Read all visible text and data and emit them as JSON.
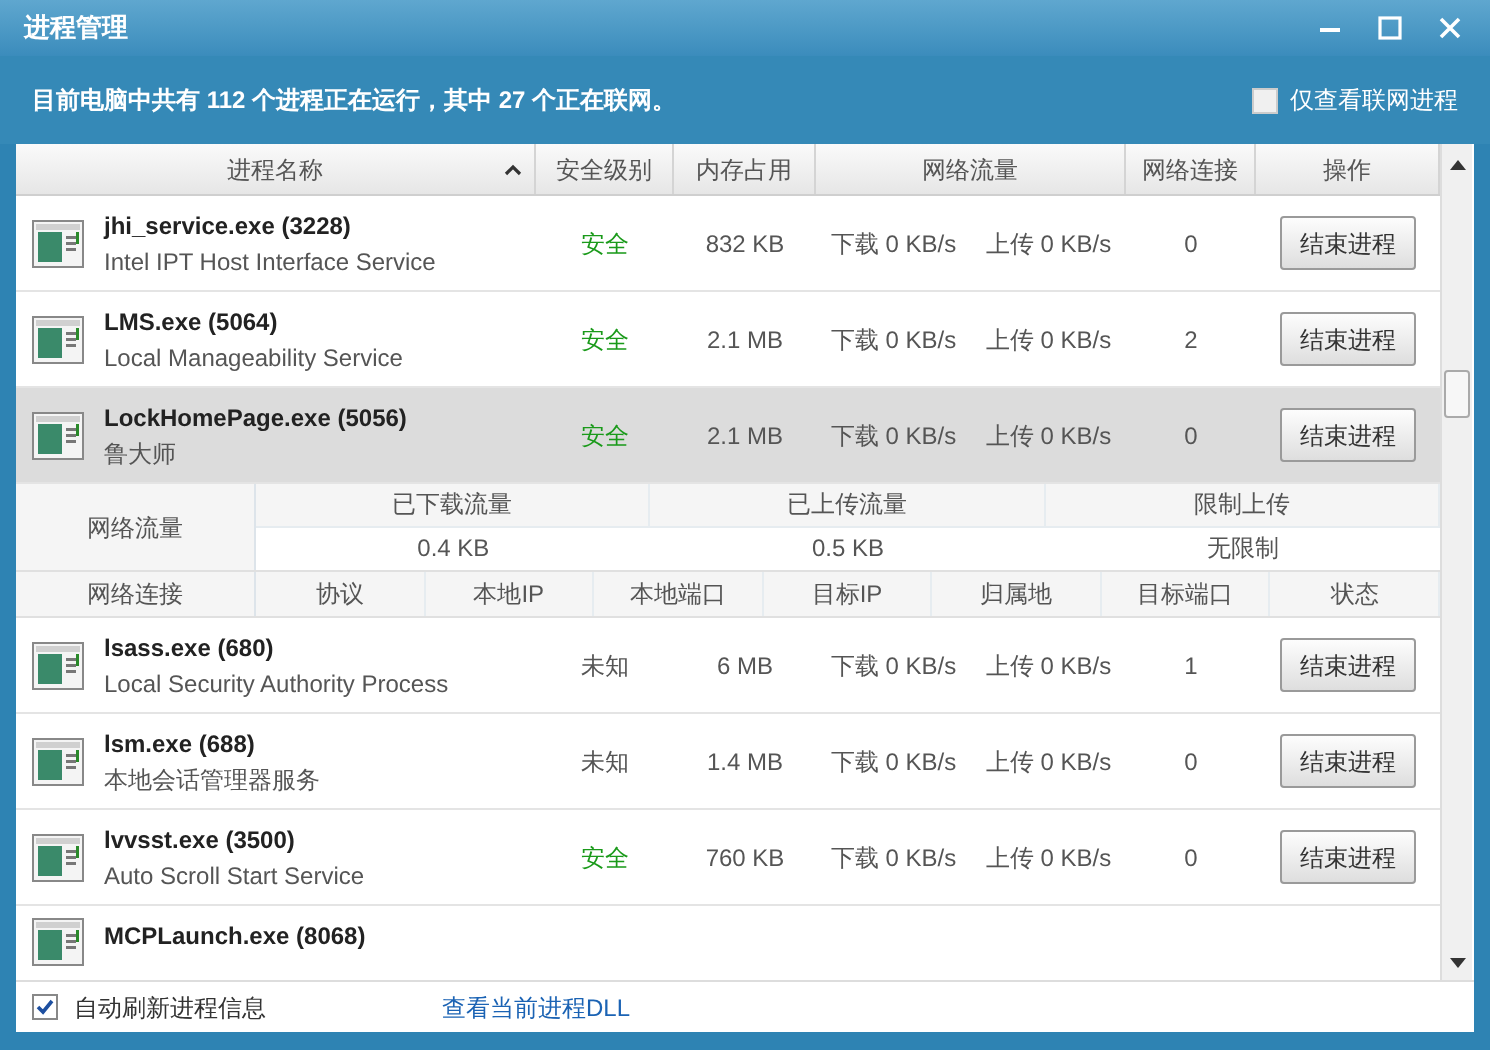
{
  "window": {
    "title": "进程管理"
  },
  "summary": {
    "text": "目前电脑中共有 112 个进程正在运行，其中 27 个正在联网。",
    "filter_label": "仅查看联网进程",
    "filter_checked": false
  },
  "columns": [
    "进程名称",
    "安全级别",
    "内存占用",
    "网络流量",
    "网络连接",
    "操作"
  ],
  "processes": [
    {
      "kind": "full",
      "name": "jhi_service.exe (3228)",
      "description": "Intel IPT Host Interface Service",
      "security": "安全",
      "color": "#1a9a1a",
      "memory": "832 KB",
      "download": "下载 0 KB/s",
      "upload": "上传 0 KB/s",
      "connections": "0",
      "button": "结束进程",
      "selected": false
    },
    {
      "kind": "full",
      "name": "LMS.exe (5064)",
      "description": "Local Manageability Service",
      "security": "安全",
      "color": "#1a9a1a",
      "memory": "2.1 MB",
      "download": "下载 0 KB/s",
      "upload": "上传 0 KB/s",
      "connections": "2",
      "button": "结束进程",
      "selected": false
    },
    {
      "kind": "full",
      "name": "LockHomePage.exe (5056)",
      "description": "鲁大师",
      "security": "安全",
      "color": "#1a9a1a",
      "memory": "2.1 MB",
      "download": "下载 0 KB/s",
      "upload": "上传 0 KB/s",
      "connections": "0",
      "button": "结束进程",
      "selected": true,
      "detail": {
        "traffic_label": "网络流量",
        "traffic_columns": [
          "已下载流量",
          "已上传流量",
          "限制上传"
        ],
        "traffic_values": [
          "0.4 KB",
          "0.5 KB",
          "无限制"
        ],
        "connections_label": "网络连接",
        "connection_columns": [
          "协议",
          "本地IP",
          "本地端口",
          "目标IP",
          "归属地",
          "目标端口",
          "状态"
        ]
      }
    },
    {
      "kind": "full",
      "name": "lsass.exe (680)",
      "description": "Local Security Authority Process",
      "security": "未知",
      "color": "#555555",
      "memory": "6 MB",
      "download": "下载 0 KB/s",
      "upload": "上传 0 KB/s",
      "connections": "1",
      "button": "结束进程",
      "selected": false
    },
    {
      "kind": "full",
      "name": "lsm.exe (688)",
      "description": "本地会话管理器服务",
      "security": "未知",
      "color": "#555555",
      "memory": "1.4 MB",
      "download": "下载 0 KB/s",
      "upload": "上传 0 KB/s",
      "connections": "0",
      "button": "结束进程",
      "selected": false
    },
    {
      "kind": "full",
      "name": "lvvsst.exe (3500)",
      "description": "Auto Scroll Start Service",
      "security": "安全",
      "color": "#1a9a1a",
      "memory": "760 KB",
      "download": "下载 0 KB/s",
      "upload": "上传 0 KB/s",
      "connections": "0",
      "button": "结束进程",
      "selected": false
    },
    {
      "kind": "partial",
      "name": "MCPLaunch.exe (8068)",
      "selected": false
    }
  ],
  "footer": {
    "auto_refresh_label": "自动刷新进程信息",
    "auto_refresh_checked": true,
    "link": "查看当前进程DLL"
  }
}
